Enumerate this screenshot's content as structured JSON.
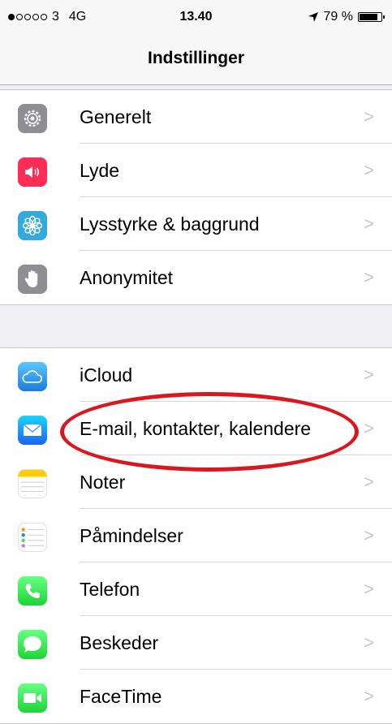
{
  "status": {
    "signal_label": "3",
    "network": "4G",
    "time": "13.40",
    "battery": "79 %",
    "battery_level": 0.79
  },
  "nav": {
    "title": "Indstillinger"
  },
  "groups": [
    {
      "items": [
        {
          "label": "Generelt",
          "icon": "gear-icon",
          "color": "#8e8e93"
        },
        {
          "label": "Lyde",
          "icon": "speaker-icon",
          "color": "#ff2d55"
        },
        {
          "label": "Lysstyrke & baggrund",
          "icon": "flower-icon",
          "color": "#34aadc"
        },
        {
          "label": "Anonymitet",
          "icon": "hand-icon",
          "color": "#8e8e93"
        }
      ]
    },
    {
      "items": [
        {
          "label": "iCloud",
          "icon": "cloud-icon",
          "color": "#5ac8fa"
        },
        {
          "label": "E-mail, kontakter, kalendere",
          "icon": "envelope-icon",
          "color": "#1f8ef1"
        },
        {
          "label": "Noter",
          "icon": "notes-icon",
          "color": "#ffcc00"
        },
        {
          "label": "Påmindelser",
          "icon": "reminders-icon",
          "color": "#ffffff"
        },
        {
          "label": "Telefon",
          "icon": "phone-icon",
          "color": "#4cd964"
        },
        {
          "label": "Beskeder",
          "icon": "messages-icon",
          "color": "#4cd964"
        },
        {
          "label": "FaceTime",
          "icon": "video-camera-icon",
          "color": "#4cd964"
        }
      ]
    }
  ],
  "chevron": ">"
}
